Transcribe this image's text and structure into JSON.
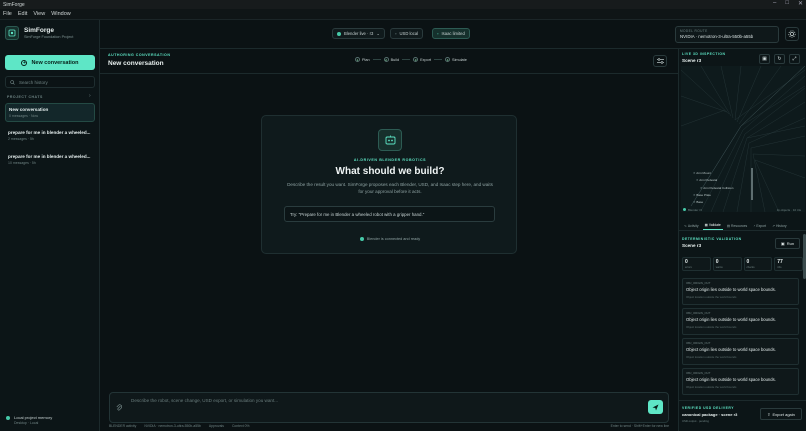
{
  "window": {
    "title": "SimForge",
    "controls": [
      "–",
      "□",
      "✕"
    ]
  },
  "menu": [
    "File",
    "Edit",
    "View",
    "Window"
  ],
  "sidebar": {
    "app_name": "SimForge",
    "project": "SimForge Foundation Project",
    "new_conversation": "New conversation",
    "search_placeholder": "Search history",
    "section_label": "PROJECT CHATS",
    "conversations": [
      {
        "title": "New conversation",
        "meta": "0 messages · Now"
      },
      {
        "title": "prepare for me in blender a wheeled...",
        "meta": "2 messages · 5h"
      },
      {
        "title": "prepare for me in blender a wheeled...",
        "meta": "10 messages · 5h"
      }
    ],
    "footer_title": "Local project memory",
    "footer_sub": "Desktop · Local"
  },
  "topbar": {
    "blender": "Blender live · r3",
    "usd": "USD local",
    "isaac": "Isaac limited",
    "model_label": "MODEL ROUTE",
    "model_value": "NVIDIA · nemotron-3-ultra-550b-a55b"
  },
  "main": {
    "section_label": "AUTHORING CONVERSATION",
    "title": "New conversation",
    "steps": [
      {
        "n": "1",
        "label": "Plan"
      },
      {
        "n": "2",
        "label": "Build"
      },
      {
        "n": "3",
        "label": "Export"
      },
      {
        "n": "4",
        "label": "Simulate"
      }
    ],
    "card": {
      "tag": "AI-DRIVEN BLENDER ROBOTICS",
      "title": "What should we build?",
      "description": "Describe the result you want. SimForge proposes each Blender, USD, and Isaac step here, and waits for your approval before it acts.",
      "suggestion": "Try: \"Prepare for me in Blender a wheeled robot with a gripper hand.\"",
      "status": "Blender is connected and ready"
    },
    "composer_placeholder": "Describe the robot, scene change, USD export, or simulation you want...",
    "status_items": [
      "BLENDER activity",
      "NVIDIA · nemotron-3-ultra-550b-a55b",
      "Approvals",
      "Context 0%"
    ],
    "status_right": "Enter to send · Shift+Enter for new line"
  },
  "right_panel": {
    "inspection_label": "LIVE 3D INSPECTION",
    "scene": "Scene r3",
    "outliner": [
      "Arm Mount",
      "Arm Pedestal",
      "Arm Pedestal Collision",
      "Base Plate",
      "Base"
    ],
    "viewport_left": "Blender r3",
    "viewport_right": "11 objects · 10 tris",
    "tabs": [
      "Activity",
      "Validate",
      "Resources",
      "Export",
      "History"
    ],
    "validation_label": "DETERMINISTIC VALIDATION",
    "validation_scene": "Scene r3",
    "run": "Run",
    "stats": [
      {
        "n": "0",
        "l": "errors"
      },
      {
        "n": "0",
        "l": "warns"
      },
      {
        "n": "0",
        "l": "checks"
      },
      {
        "n": "77",
        "l": "info"
      }
    ],
    "issues": [
      {
        "code": "OBJ_ORIGIN_OUT",
        "msg": "Object origin lies outside to world space bounds.",
        "sub": "Object location outside the world bounds"
      },
      {
        "code": "OBJ_ORIGIN_OUT",
        "msg": "Object origin lies outside to world space bounds.",
        "sub": "Object location outside the world bounds"
      },
      {
        "code": "OBJ_ORIGIN_OUT",
        "msg": "Object origin lies outside to world space bounds.",
        "sub": "Object location outside the world bounds"
      },
      {
        "code": "OBJ_ORIGIN_OUT",
        "msg": "Object origin lies outside to world space bounds.",
        "sub": "Object location outside the world bounds"
      }
    ],
    "delivery_label": "VERIFIED USD DELIVERY",
    "delivery_title": "canonical package · scene r3",
    "delivery_sub": "USD output · pending",
    "export_again": "Export again"
  }
}
